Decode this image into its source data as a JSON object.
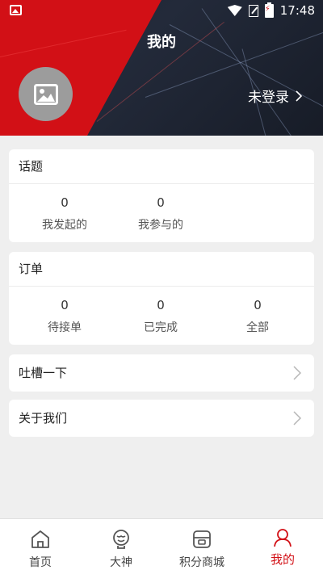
{
  "status_bar": {
    "time": "17:48"
  },
  "header": {
    "title": "我的",
    "login_label": "未登录"
  },
  "topics": {
    "title": "话题",
    "items": [
      {
        "value": "0",
        "label": "我发起的"
      },
      {
        "value": "0",
        "label": "我参与的"
      }
    ]
  },
  "orders": {
    "title": "订单",
    "items": [
      {
        "value": "0",
        "label": "待接单"
      },
      {
        "value": "0",
        "label": "已完成"
      },
      {
        "value": "0",
        "label": "全部"
      }
    ]
  },
  "menu": [
    {
      "label": "吐槽一下"
    },
    {
      "label": "关于我们"
    }
  ],
  "tabbar": {
    "items": [
      {
        "label": "首页",
        "icon": "home-icon"
      },
      {
        "label": "大神",
        "icon": "master-icon"
      },
      {
        "label": "积分商城",
        "icon": "mall-icon"
      },
      {
        "label": "我的",
        "icon": "user-icon"
      }
    ],
    "active": "我的"
  },
  "colors": {
    "accent": "#d21016",
    "background": "#efefef"
  }
}
